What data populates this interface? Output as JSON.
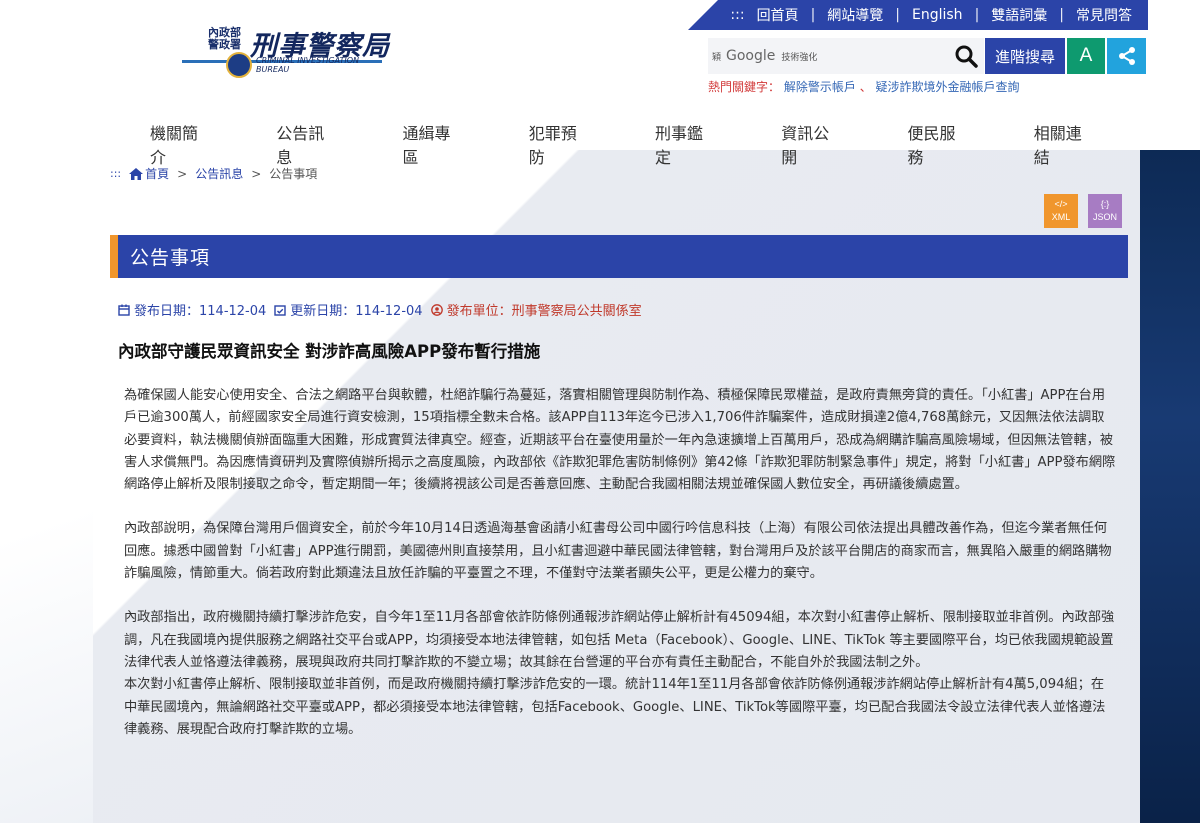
{
  "topbar": {
    "prefix": ":::",
    "links": [
      "回首頁",
      "網站導覽",
      "English",
      "雙語詞彙",
      "常見問答"
    ]
  },
  "logo": {
    "small_text": "內政部\n警政署",
    "name": "刑事警察局",
    "english": "CRIMINAL INVESTIGATION BUREAU"
  },
  "search": {
    "google_prefix": "㯋",
    "google_label": "Google",
    "google_tag": "技術強化",
    "advanced_label": "進階搜尋",
    "font_button": "A"
  },
  "hot_keywords": {
    "label": "熱門關鍵字：",
    "items": [
      "解除警示帳戶",
      "疑涉詐欺境外金融帳戶查詢"
    ],
    "separator": "、"
  },
  "nav": {
    "items": [
      "機關簡介",
      "公告訊息",
      "通緝專區",
      "犯罪預防",
      "刑事鑑定",
      "資訊公開",
      "便民服務",
      "相關連結"
    ]
  },
  "breadcrumb": {
    "dots": ":::",
    "home": "首頁",
    "items": [
      "公告訊息",
      "公告事項"
    ],
    "arrow": ">"
  },
  "export": {
    "xml_icon": "</>",
    "xml": "XML",
    "json_icon": "{:}",
    "json": "JSON"
  },
  "section_title": "公告事項",
  "meta": {
    "publish_label": "發布日期：114-12-04",
    "update_label": "更新日期：114-12-04",
    "unit_label": "發布單位：刑事警察局公共關係室"
  },
  "article": {
    "title": "內政部守護民眾資訊安全 對涉詐高風險APP發布暫行措施",
    "p1": "為確保國人能安心使用安全、合法之網路平台與軟體，杜絕詐騙行為蔓延，落實相關管理與防制作為、積極保障民眾權益，是政府責無旁貸的責任。「小紅書」APP在台用戶已逾300萬人，前經國家安全局進行資安檢測，15項指標全數未合格。該APP自113年迄今已涉入1,706件詐騙案件，造成財損達2億4,768萬餘元，又因無法依法調取必要資料，執法機關偵辦面臨重大困難，形成實質法律真空。經查，近期該平台在臺使用量於一年內急速擴增上百萬用戶，恐成為網購詐騙高風險場域，但因無法管轄，被害人求償無門。為因應情資研判及實際偵辦所揭示之高度風險，內政部依《詐欺犯罪危害防制條例》第42條「詐欺犯罪防制緊急事件」規定，將對「小紅書」APP發布網際網路停止解析及限制接取之命令，暫定期間一年；後續將視該公司是否善意回應、主動配合我國相關法規並確保國人數位安全，再研議後續處置。",
    "p2": "內政部說明，為保障台灣用戶個資安全，前於今年10月14日透過海基會函請小紅書母公司中國行吟信息科技（上海）有限公司依法提出具體改善作為，但迄今業者無任何回應。據悉中國曾對「小紅書」APP進行開罰，美國德州則直接禁用，且小紅書迴避中華民國法律管轄，對台灣用戶及於該平台開店的商家而言，無異陷入嚴重的網路購物詐騙風險，情節重大。倘若政府對此類違法且放任詐騙的平臺置之不理，不僅對守法業者顯失公平，更是公權力的棄守。",
    "p3": "內政部指出，政府機關持續打擊涉詐危安，自今年1至11月各部會依詐防條例通報涉詐網站停止解析計有45094組，本次對小紅書停止解析、限制接取並非首例。內政部強調，凡在我國境內提供服務之網路社交平台或APP，均須接受本地法律管轄，如包括 Meta（Facebook）、Google、LINE、TikTok 等主要國際平台，均已依我國規範設置法律代表人並恪遵法律義務，展現與政府共同打擊詐欺的不變立場；故其餘在台營運的平台亦有責任主動配合，不能自外於我國法制之外。",
    "p4": "本次對小紅書停止解析、限制接取並非首例，而是政府機關持續打擊涉詐危安的一環。統計114年1至11月各部會依詐防條例通報涉詐網站停止解析計有4萬5,094組；在中華民國境內，無論網路社交平臺或APP，都必須接受本地法律管轄，包括Facebook、Google、LINE、TikTok等國際平臺，均已配合我國法令設立法律代表人並恪遵法律義務、展現配合政府打擊詐欺的立場。"
  }
}
